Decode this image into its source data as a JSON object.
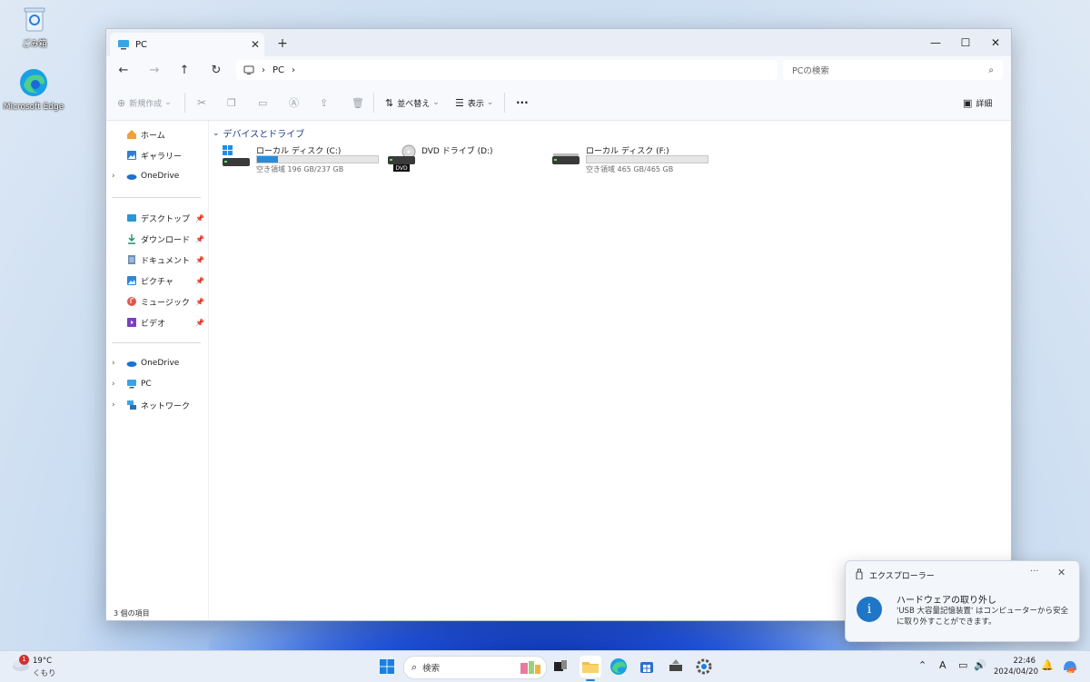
{
  "desktop": {
    "icons": [
      {
        "label": "ごみ箱",
        "icon": "recycle-bin-icon"
      },
      {
        "label": "Microsoft Edge",
        "icon": "edge-icon"
      }
    ]
  },
  "window": {
    "tab_title": "PC",
    "tab_close": "✕",
    "new_tab": "+",
    "address": {
      "segment": "PC",
      "separator": "›"
    },
    "search_placeholder": "PCの検索",
    "caption": {
      "minimize": "—",
      "maximize": "☐",
      "close": "✕"
    }
  },
  "toolbar": {
    "new_label": "新規作成",
    "sort_label": "並べ替え",
    "view_label": "表示",
    "more_label": "···",
    "details_label": "詳細"
  },
  "sidebar": {
    "top": [
      {
        "label": "ホーム",
        "icon": "home-icon"
      },
      {
        "label": "ギャラリー",
        "icon": "gallery-icon"
      },
      {
        "label": "OneDrive",
        "icon": "onedrive-icon"
      }
    ],
    "pinned": [
      {
        "label": "デスクトップ",
        "icon": "desktop-folder-icon"
      },
      {
        "label": "ダウンロード",
        "icon": "download-icon"
      },
      {
        "label": "ドキュメント",
        "icon": "documents-icon"
      },
      {
        "label": "ピクチャ",
        "icon": "pictures-icon"
      },
      {
        "label": "ミュージック",
        "icon": "music-icon"
      },
      {
        "label": "ビデオ",
        "icon": "videos-icon"
      }
    ],
    "bottom": [
      {
        "label": "OneDrive",
        "icon": "onedrive-icon"
      },
      {
        "label": "PC",
        "icon": "pc-icon"
      },
      {
        "label": "ネットワーク",
        "icon": "network-icon"
      }
    ]
  },
  "content": {
    "group_label": "デバイスとドライブ",
    "drives": [
      {
        "name": "ローカル ディスク (C:)",
        "free": "空き領域 196 GB/237 GB",
        "used_fraction": 0.17
      },
      {
        "name": "DVD ドライブ (D:)",
        "badge": "DVD"
      },
      {
        "name": "ローカル ディスク (F:)",
        "free": "空き領域 465 GB/465 GB",
        "used_fraction": 0.0
      }
    ],
    "status": "3 個の項目"
  },
  "toast": {
    "app": "エクスプローラー",
    "more": "···",
    "close": "✕",
    "title": "ハードウェアの取り外し",
    "body": "'USB 大容量記憶装置' はコンピューターから安全に取り外すことができます。"
  },
  "taskbar": {
    "weather": {
      "temp": "19°C",
      "cond": "くもり",
      "badge": "1"
    },
    "search_label": "検索",
    "time": "22:46",
    "date": "2024/04/20",
    "ime": "A"
  }
}
